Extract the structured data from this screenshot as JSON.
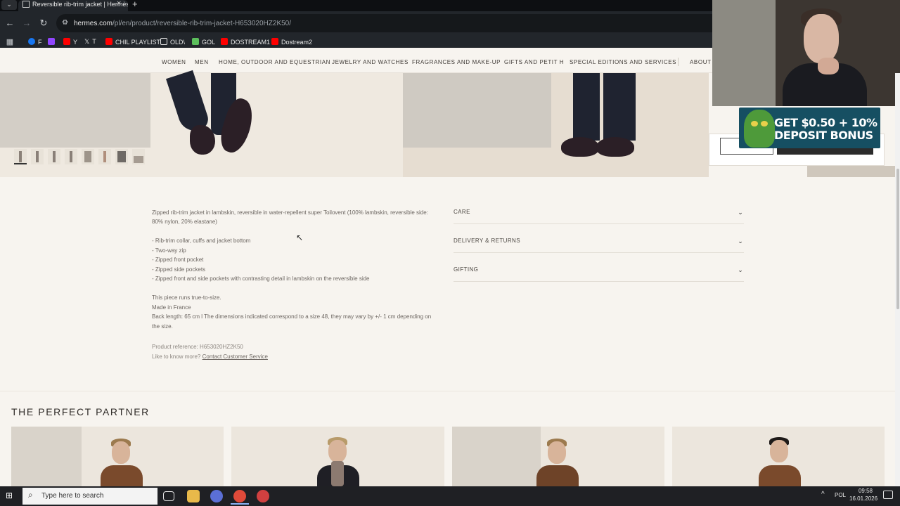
{
  "browser": {
    "tab_title": "Reversible rib-trim jacket | Hermès",
    "tab_close": "×",
    "new_tab": "+",
    "tab_menu": "⌄",
    "url_host": "hermes.com",
    "url_path": "/pl/en/product/reversible-rib-trim-jacket-H653020HZ2K50/"
  },
  "bookmarks": [
    {
      "label": "F",
      "icon": "facebook-icon",
      "color": "#1877f2"
    },
    {
      "label": "",
      "icon": "twitch-icon",
      "color": "#9146ff"
    },
    {
      "label": "Y",
      "icon": "youtube-icon",
      "color": "#ff0000"
    },
    {
      "label": "T",
      "icon": "x-icon",
      "color": "#ffffff"
    },
    {
      "label": "CHIL PLAYLIST",
      "icon": "youtube-icon",
      "color": "#ff0000"
    },
    {
      "label": "OLD\\",
      "icon": "folder-icon",
      "color": "#e6e6e6"
    },
    {
      "label": "GOL",
      "icon": "gol-icon",
      "color": "#5cbf5c"
    },
    {
      "label": "DOSTREAM1",
      "icon": "youtube-icon",
      "color": "#ff0000"
    },
    {
      "label": "Dostream2",
      "icon": "youtube-icon",
      "color": "#ff0000"
    }
  ],
  "site_nav": [
    "WOMEN",
    "MEN",
    "HOME, OUTDOOR AND EQUESTRIAN",
    "JEWELRY AND WATCHES",
    "FRAGRANCES AND MAKE-UP",
    "GIFTS AND PETIT H",
    "SPECIAL EDITIONS AND SERVICES",
    "ABOUT H"
  ],
  "description": {
    "intro_line1": "Zipped rib-trim jacket in lambskin, reversible in water-repellent super Toilovent (100% lambskin, reversible side:",
    "intro_line2": "80% nylon, 20% elastane)",
    "bullets": [
      "- Rib-trim collar, cuffs and jacket bottom",
      "- Two-way zip",
      "- Zipped front pocket",
      "- Zipped side pockets",
      "- Zipped front and side pockets with contrasting detail in lambskin on the reversible side"
    ],
    "fit": "This piece runs true-to-size.",
    "origin": "Made in France",
    "length_line1": "Back length: 65 cm l The dimensions indicated correspond to a size 48, they may vary by +/- 1 cm depending on",
    "length_line2": "the size.",
    "reference": "Product reference:  H653020HZ2K50",
    "more_prefix": "Like to know more? ",
    "more_link": "Contact Customer Service"
  },
  "accordion": [
    {
      "label": "CARE"
    },
    {
      "label": "DELIVERY & RETURNS"
    },
    {
      "label": "GIFTING"
    }
  ],
  "partner": {
    "title": "THE PERFECT PARTNER"
  },
  "ad": {
    "line1": "GET $0.50 + 10%",
    "line2": "DEPOSIT BONUS"
  },
  "taskbar": {
    "search_placeholder": "Type here to search",
    "lang": "POL",
    "time": "09:58",
    "date": "16.01.2026"
  },
  "colors": {
    "page_bg": "#f7f4ef",
    "browser_chrome": "#22262b",
    "ad_bg": "#164f62"
  }
}
